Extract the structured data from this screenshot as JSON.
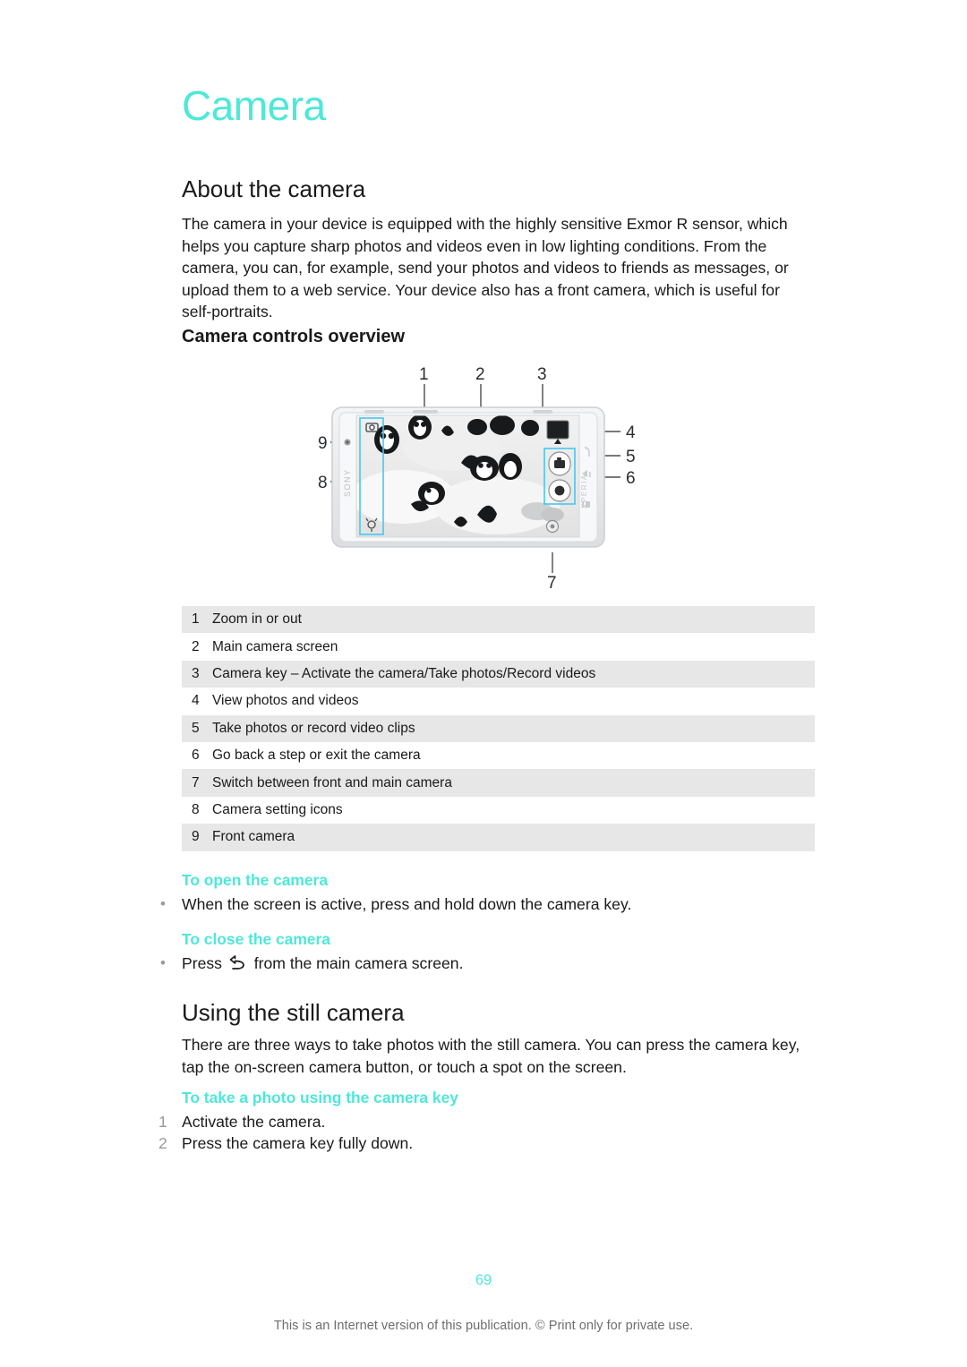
{
  "document": {
    "chapter_title": "Camera",
    "accent_color": "#4ee8d8",
    "page_number": "69",
    "footer_note": "This is an Internet version of this publication. © Print only for private use."
  },
  "sections": {
    "about": {
      "heading": "About the camera",
      "paragraph": "The camera in your device is equipped with the highly sensitive Exmor R sensor, which helps you capture sharp photos and videos even in low lighting conditions. From the camera, you can, for example, send your photos and videos to friends as messages, or upload them to a web service. Your device also has a front camera, which is useful for self-portraits."
    },
    "controls_overview": {
      "heading": "Camera controls overview",
      "diagram": {
        "device": "Sony Xperia smartphone in landscape orientation showing camera viewfinder with penguins",
        "brand_text": "SONY",
        "side_text": "XPERIA",
        "callout_labels": [
          "1",
          "2",
          "3",
          "4",
          "5",
          "6",
          "7",
          "8",
          "9"
        ],
        "highlight_color": "#44c8f0"
      },
      "legend": [
        {
          "num": "1",
          "text": "Zoom in or out"
        },
        {
          "num": "2",
          "text": "Main camera screen"
        },
        {
          "num": "3",
          "text": "Camera key – Activate the camera/Take photos/Record videos"
        },
        {
          "num": "4",
          "text": "View photos and videos"
        },
        {
          "num": "5",
          "text": "Take photos or record video clips"
        },
        {
          "num": "6",
          "text": "Go back a step or exit the camera"
        },
        {
          "num": "7",
          "text": "Switch between front and main camera"
        },
        {
          "num": "8",
          "text": "Camera setting icons"
        },
        {
          "num": "9",
          "text": "Front camera"
        }
      ],
      "procedures": [
        {
          "title": "To open the camera",
          "bullets": [
            "When the screen is active, press and hold down the camera key."
          ]
        },
        {
          "title": "To close the camera",
          "bullet_prefix": "Press",
          "bullet_icon": "back-arrow-icon",
          "bullet_suffix": "from the main camera screen."
        }
      ]
    },
    "still_camera": {
      "heading": "Using the still camera",
      "paragraph": "There are three ways to take photos with the still camera. You can press the camera key, tap the on-screen camera button, or touch a spot on the screen.",
      "procedure": {
        "title": "To take a photo using the camera key",
        "steps": [
          {
            "num": "1",
            "text": "Activate the camera."
          },
          {
            "num": "2",
            "text": "Press the camera key fully down."
          }
        ]
      }
    }
  }
}
